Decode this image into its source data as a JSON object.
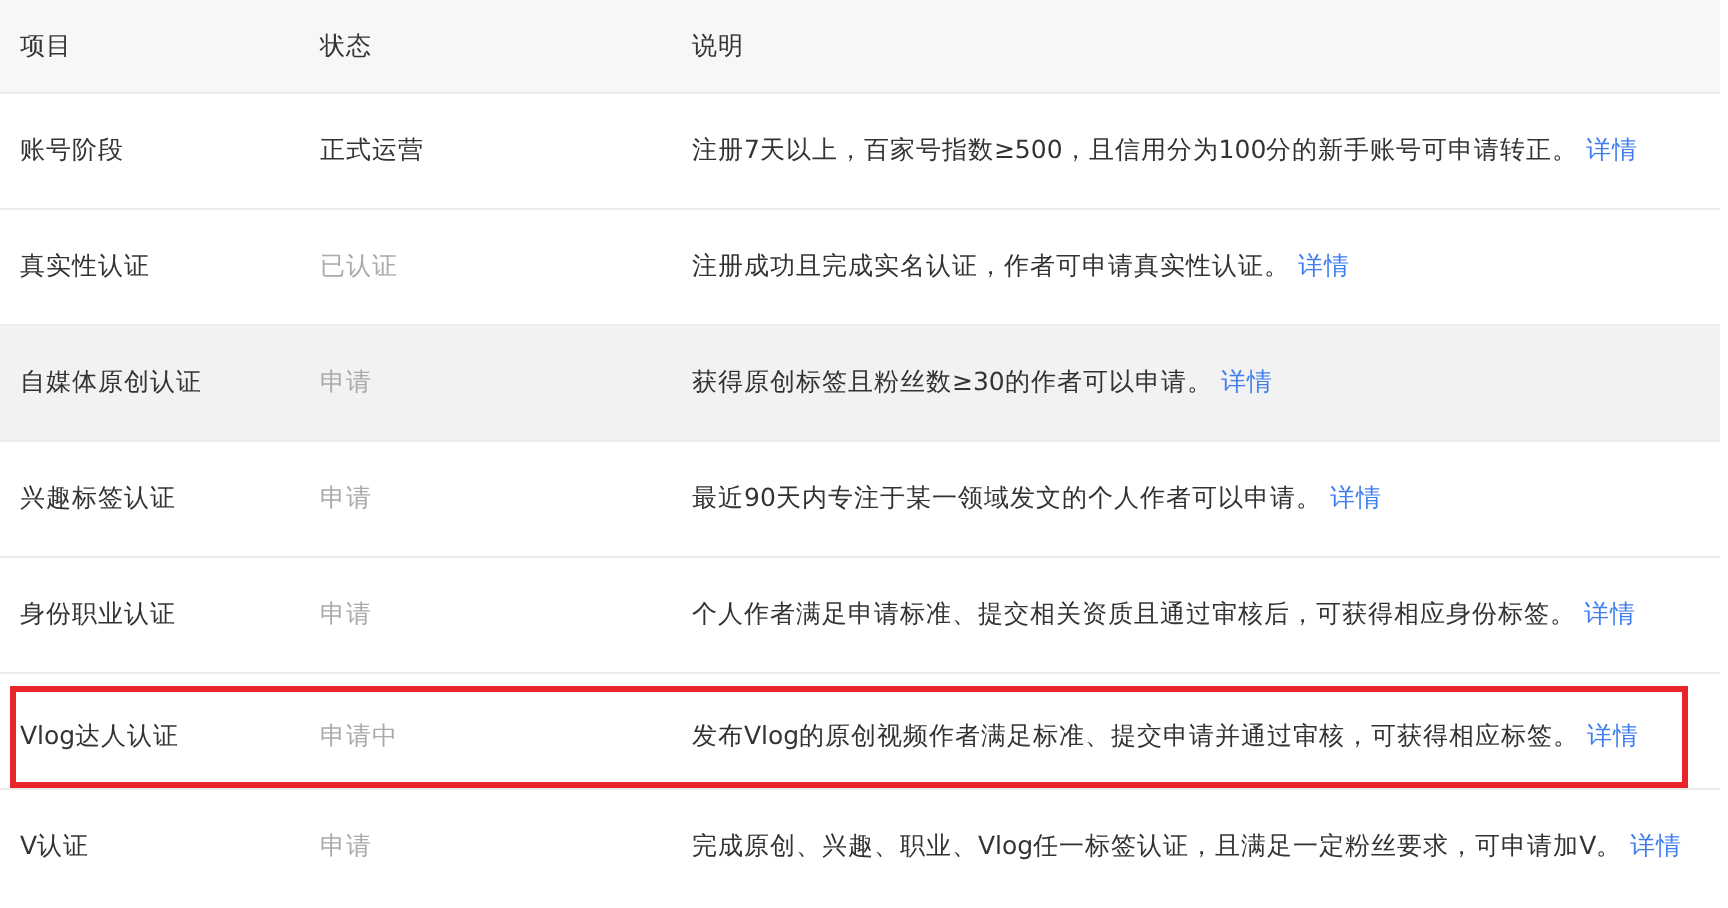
{
  "table": {
    "columns": [
      "项目",
      "状态",
      "说明"
    ],
    "rows": [
      {
        "item": "账号阶段",
        "status": "正式运营",
        "status_muted": false,
        "description": {
          "text": "注册7天以上，百家号指数≥500，且信用分为100分的新手账号可申请转正。",
          "link": "详情"
        },
        "hovered": false,
        "marked": false
      },
      {
        "item": "真实性认证",
        "status": "已认证",
        "status_muted": true,
        "description": {
          "text": "注册成功且完成实名认证，作者可申请真实性认证。",
          "link": "详情"
        },
        "hovered": false,
        "marked": false
      },
      {
        "item": "自媒体原创认证",
        "status": "申请",
        "status_muted": true,
        "description": {
          "text": "获得原创标签且粉丝数≥30的作者可以申请。",
          "link": "详情"
        },
        "hovered": true,
        "marked": false
      },
      {
        "item": "兴趣标签认证",
        "status": "申请",
        "status_muted": true,
        "description": {
          "text": "最近90天内专注于某一领域发文的个人作者可以申请。",
          "link": "详情"
        },
        "hovered": false,
        "marked": false
      },
      {
        "item": "身份职业认证",
        "status": "申请",
        "status_muted": true,
        "description": {
          "text": "个人作者满足申请标准、提交相关资质且通过审核后，可获得相应身份标签。",
          "link": "详情"
        },
        "hovered": false,
        "marked": false
      },
      {
        "item": "Vlog达人认证",
        "status": "申请中",
        "status_muted": true,
        "description": {
          "text": "发布Vlog的原创视频作者满足标准、提交申请并通过审核，可获得相应标签。",
          "link": "详情"
        },
        "hovered": false,
        "marked": true
      },
      {
        "item": "V认证",
        "status": "申请",
        "status_muted": true,
        "description": {
          "text": "完成原创、兴趣、职业、Vlog任一标签认证，且满足一定粉丝要求，可申请加V。",
          "link": "详情"
        },
        "hovered": false,
        "marked": false
      }
    ]
  }
}
